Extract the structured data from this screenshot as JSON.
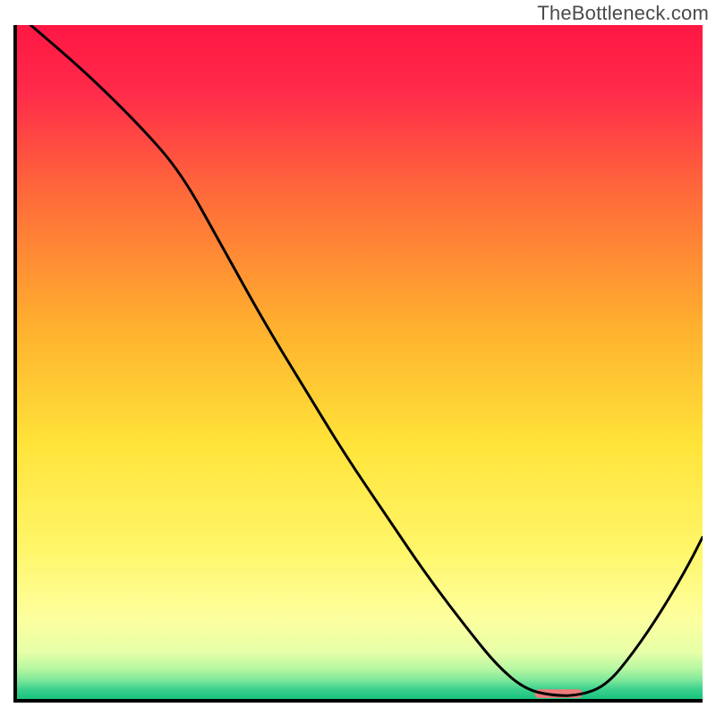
{
  "watermark": "TheBottleneck.com",
  "chart_data": {
    "type": "line",
    "title": "",
    "xlabel": "",
    "ylabel": "",
    "xlim": [
      0,
      100
    ],
    "ylim": [
      0,
      100
    ],
    "grid": false,
    "legend": false,
    "background": {
      "type": "vertical-gradient",
      "stops": [
        {
          "pos": 0.0,
          "color": "#ff1744"
        },
        {
          "pos": 0.1,
          "color": "#ff2b4a"
        },
        {
          "pos": 0.25,
          "color": "#ff6a3a"
        },
        {
          "pos": 0.45,
          "color": "#ffb12e"
        },
        {
          "pos": 0.62,
          "color": "#ffe339"
        },
        {
          "pos": 0.78,
          "color": "#fff66a"
        },
        {
          "pos": 0.88,
          "color": "#fdff9e"
        },
        {
          "pos": 0.93,
          "color": "#e7ffa8"
        },
        {
          "pos": 0.955,
          "color": "#b8f7a2"
        },
        {
          "pos": 0.972,
          "color": "#7ee79a"
        },
        {
          "pos": 0.985,
          "color": "#3ed28e"
        },
        {
          "pos": 1.0,
          "color": "#17c27f"
        }
      ]
    },
    "series": [
      {
        "name": "bottleneck-curve",
        "stroke": "#000000",
        "stroke_width": 3,
        "x": [
          2,
          10,
          18,
          24,
          30,
          36,
          42,
          48,
          54,
          60,
          66,
          70,
          74,
          78,
          82,
          86,
          90,
          94,
          98,
          100
        ],
        "y": [
          100,
          93,
          85,
          78,
          67,
          56,
          46,
          36,
          27,
          18,
          10,
          5,
          1.5,
          0.5,
          0.5,
          2,
          7,
          13,
          20,
          24
        ]
      }
    ],
    "marker": {
      "name": "optimal-marker",
      "x_range": [
        75.5,
        82.5
      ],
      "y": 0.8,
      "color": "#ef7b7b",
      "height_pct": 1.3
    }
  }
}
